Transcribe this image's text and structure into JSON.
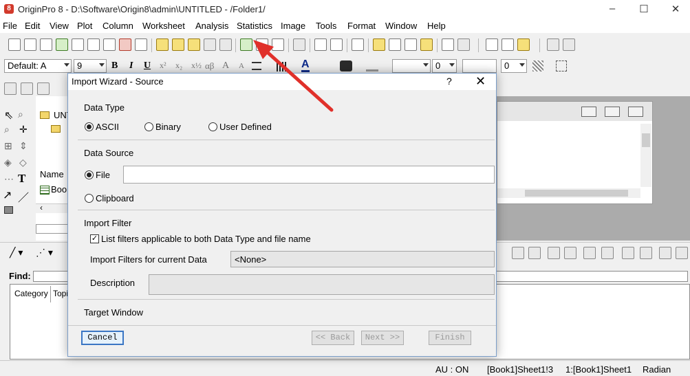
{
  "titlebar": {
    "title": "OriginPro 8 - D:\\Software\\Origin8\\admin\\UNTITLED - /Folder1/"
  },
  "menubar": [
    "File",
    "Edit",
    "View",
    "Plot",
    "Column",
    "Worksheet",
    "Analysis",
    "Statistics",
    "Image",
    "Tools",
    "Format",
    "Window",
    "Help"
  ],
  "format_toolbar": {
    "font": "Default: A",
    "size": "9",
    "bold": "B",
    "italic": "I",
    "underline": "U",
    "superscript": "x²",
    "subscript": "x₂",
    "supersub": "x½",
    "greek": "αβ",
    "larger": "A",
    "smaller": "A",
    "line_width": "0",
    "border_width": "0"
  },
  "project_explorer": {
    "folder_label": "UNT",
    "name_header": "Name",
    "book_item": "Boo"
  },
  "find": {
    "label": "Find:"
  },
  "help_tabs": [
    "Category",
    "Topi"
  ],
  "dialog": {
    "title": "Import Wizard - Source",
    "help_glyph": "?",
    "close_glyph": "✕",
    "data_type": {
      "label": "Data Type",
      "options": [
        "ASCII",
        "Binary",
        "User Defined"
      ],
      "selected": "ASCII"
    },
    "data_source": {
      "label": "Data Source",
      "file_label": "File",
      "file_value": "",
      "clipboard_label": "Clipboard",
      "selected": "File"
    },
    "import_filter": {
      "label": "Import Filter",
      "checkbox_label": "List filters applicable to both Data Type and file name",
      "checkbox_checked": true,
      "current_label": "Import Filters for current Data",
      "current_value": "<None>",
      "description_label": "Description",
      "description_value": ""
    },
    "target_window": {
      "label": "Target Window"
    },
    "buttons": {
      "cancel": "Cancel",
      "back": "<< Back",
      "next": "Next >>",
      "finish": "Finish"
    }
  },
  "statusbar": {
    "au": "AU : ON",
    "sheet": "[Book1]Sheet1!3",
    "ref": "1:[Book1]Sheet1",
    "unit": "Radian"
  },
  "colors": {
    "annotation_arrow": "#e0302a",
    "dialog_border": "#7a9dc9",
    "default_button_border": "#3a76c4"
  }
}
